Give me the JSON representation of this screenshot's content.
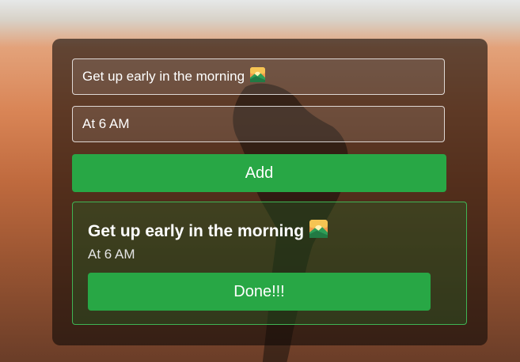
{
  "form": {
    "title_value": "Get up early in the morning",
    "title_icon": "sunrise-icon",
    "time_value": "At 6 AM",
    "add_label": "Add"
  },
  "task": {
    "title": "Get up early in the morning",
    "title_icon": "sunrise-icon",
    "time": "At 6 AM",
    "done_label": "Done!!!"
  },
  "colors": {
    "accent": "#28a745",
    "task_border": "#3fb454"
  }
}
